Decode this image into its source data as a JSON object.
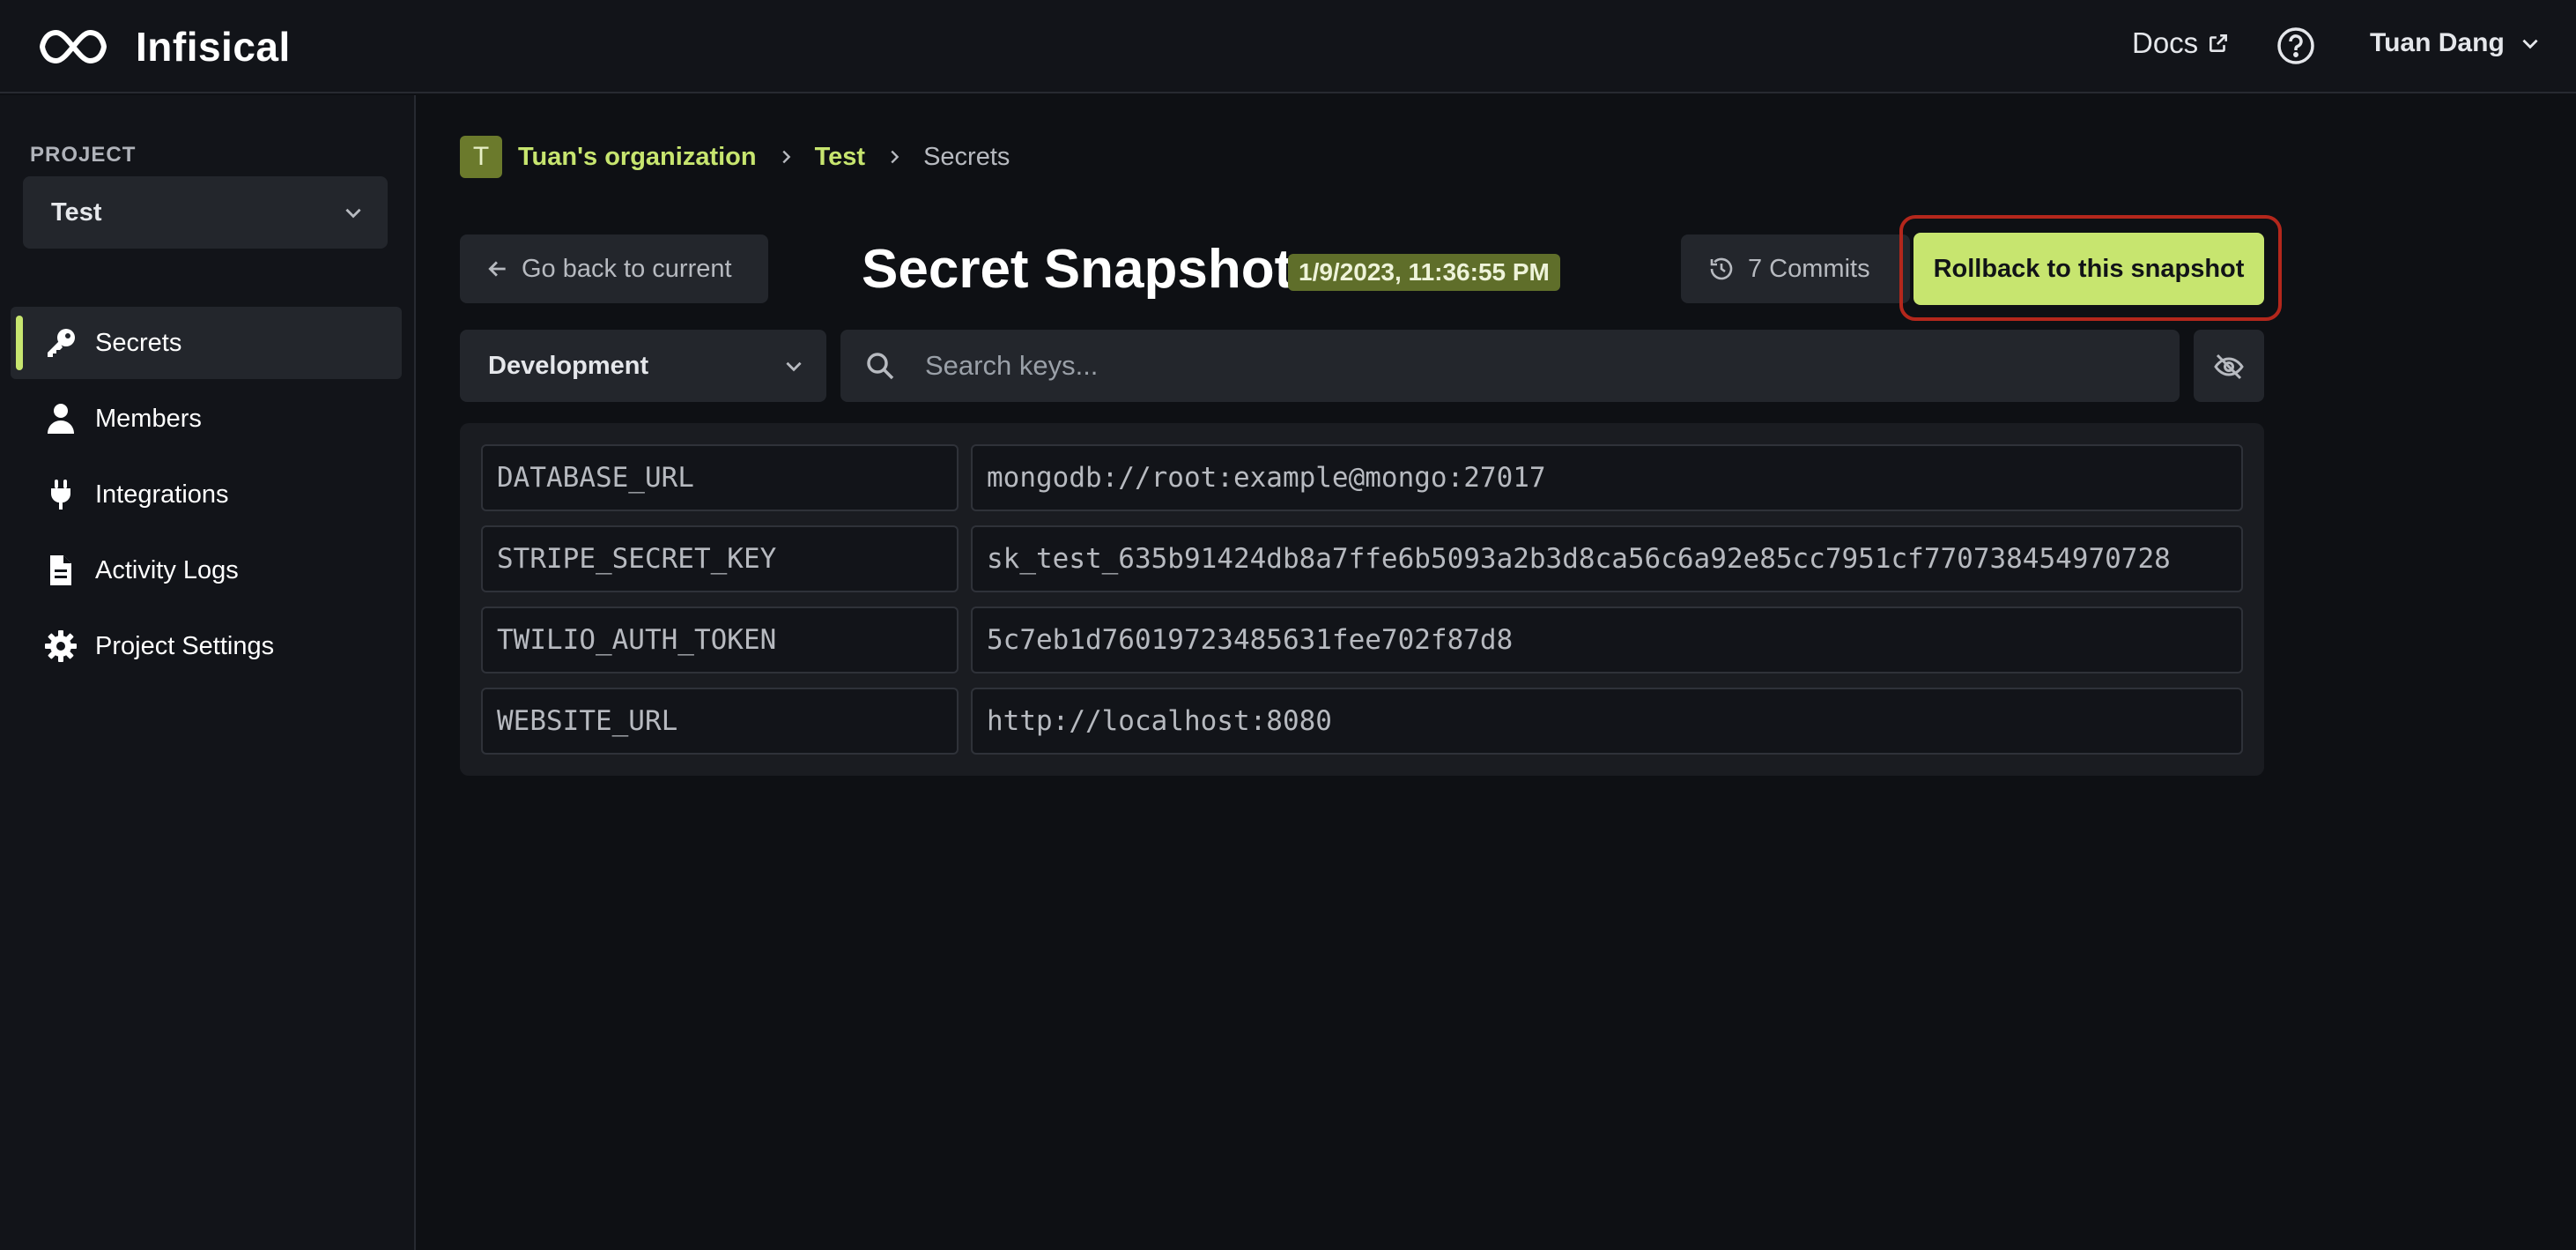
{
  "app": {
    "name": "Infisical"
  },
  "header": {
    "docs_label": "Docs",
    "user_name": "Tuan Dang"
  },
  "sidebar": {
    "project_label": "PROJECT",
    "project_name": "Test",
    "items": [
      {
        "label": "Secrets",
        "icon": "key-icon",
        "active": true
      },
      {
        "label": "Members",
        "icon": "user-icon",
        "active": false
      },
      {
        "label": "Integrations",
        "icon": "plug-icon",
        "active": false
      },
      {
        "label": "Activity Logs",
        "icon": "file-icon",
        "active": false
      },
      {
        "label": "Project Settings",
        "icon": "gear-icon",
        "active": false
      }
    ]
  },
  "breadcrumb": {
    "org_initial": "T",
    "org_name": "Tuan's organization",
    "project": "Test",
    "current": "Secrets"
  },
  "snapshot": {
    "back_label": "Go back to current",
    "title": "Secret Snapshot",
    "date": "1/9/2023, 11:36:55 PM",
    "commits_label": "7 Commits",
    "rollback_label": "Rollback to this snapshot"
  },
  "filters": {
    "environment": "Development",
    "search_placeholder": "Search keys..."
  },
  "secrets": [
    {
      "key": "DATABASE_URL",
      "value": "mongodb://root:example@mongo:27017"
    },
    {
      "key": "STRIPE_SECRET_KEY",
      "value": "sk_test_635b91424db8a7ffe6b5093a2b3d8ca56c6a92e85cc7951cf770738454970728"
    },
    {
      "key": "TWILIO_AUTH_TOKEN",
      "value": "5c7eb1d76019723485631fee702f87d8"
    },
    {
      "key": "WEBSITE_URL",
      "value": "http://localhost:8080"
    }
  ],
  "colors": {
    "accent": "#c7e56f",
    "highlight_outline": "#b4271c",
    "background": "#0e1014"
  }
}
